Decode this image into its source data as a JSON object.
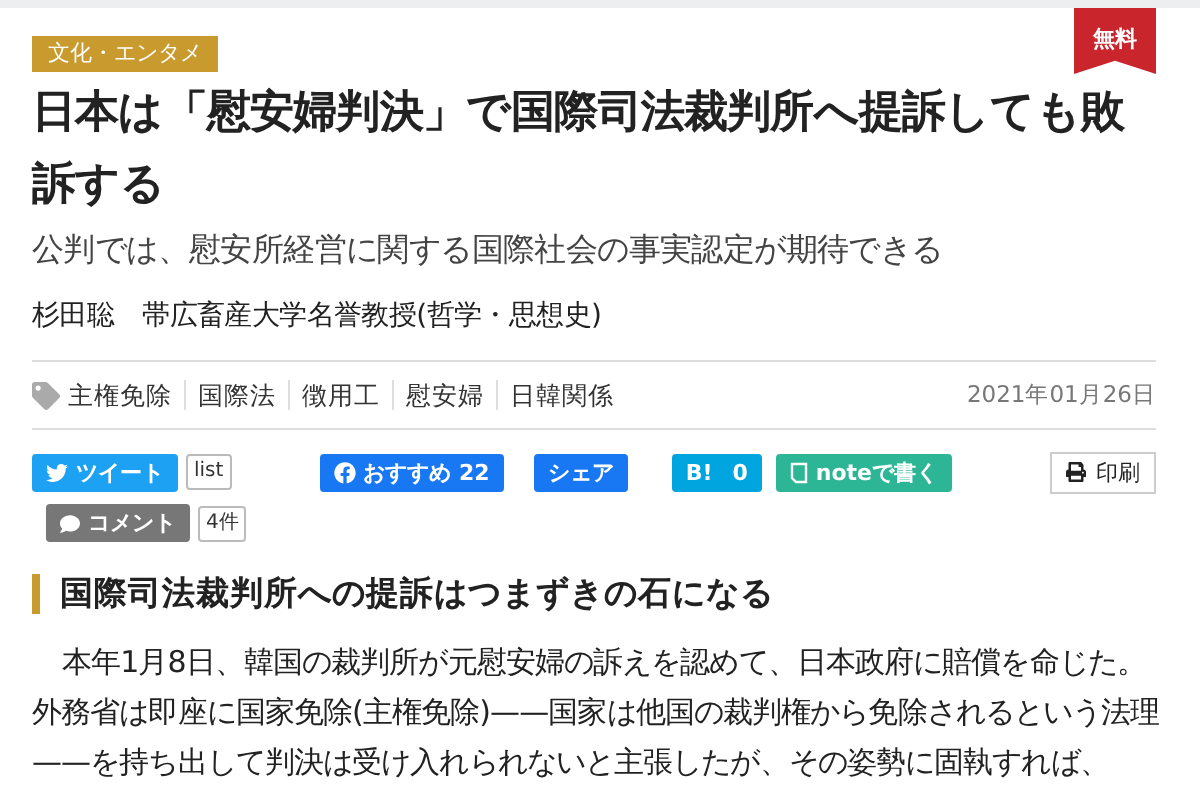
{
  "category": "文化・エンタメ",
  "badge": "無料",
  "title": "日本は「慰安婦判決」で国際司法裁判所へ提訴しても敗訴する",
  "subtitle": "公判では、慰安所経営に関する国際社会の事実認定が期待できる",
  "author": {
    "name": "杉田聡",
    "affiliation": "帯広畜産大学名誉教授(哲学・思想史)"
  },
  "tags": [
    "主権免除",
    "国際法",
    "徴用工",
    "慰安婦",
    "日韓関係"
  ],
  "date": "2021年01月26日",
  "share_buttons": [
    {
      "kind": "twitter",
      "label": "ツイート",
      "count": "list"
    },
    {
      "kind": "facebook",
      "label": "おすすめ 22"
    },
    {
      "kind": "share",
      "label": "シェア"
    },
    {
      "kind": "hatena",
      "label": "B!",
      "count": "0"
    },
    {
      "kind": "note",
      "label": "noteで書く"
    }
  ],
  "print_button": "印刷",
  "comment": {
    "label": "コメント",
    "count": "4件"
  },
  "section_heading": "国際司法裁判所への提訴はつまずきの石になる",
  "body": "本年1月8日、韓国の裁判所が元慰安婦の訴えを認めて、日本政府に賠償を命じた。外務省は即座に国家免除(主権免除)——国家は他国の裁判権から免除されるという法理——を持ち出して判決は受け入れられないと主張したが、その姿勢に固執すれば、"
}
